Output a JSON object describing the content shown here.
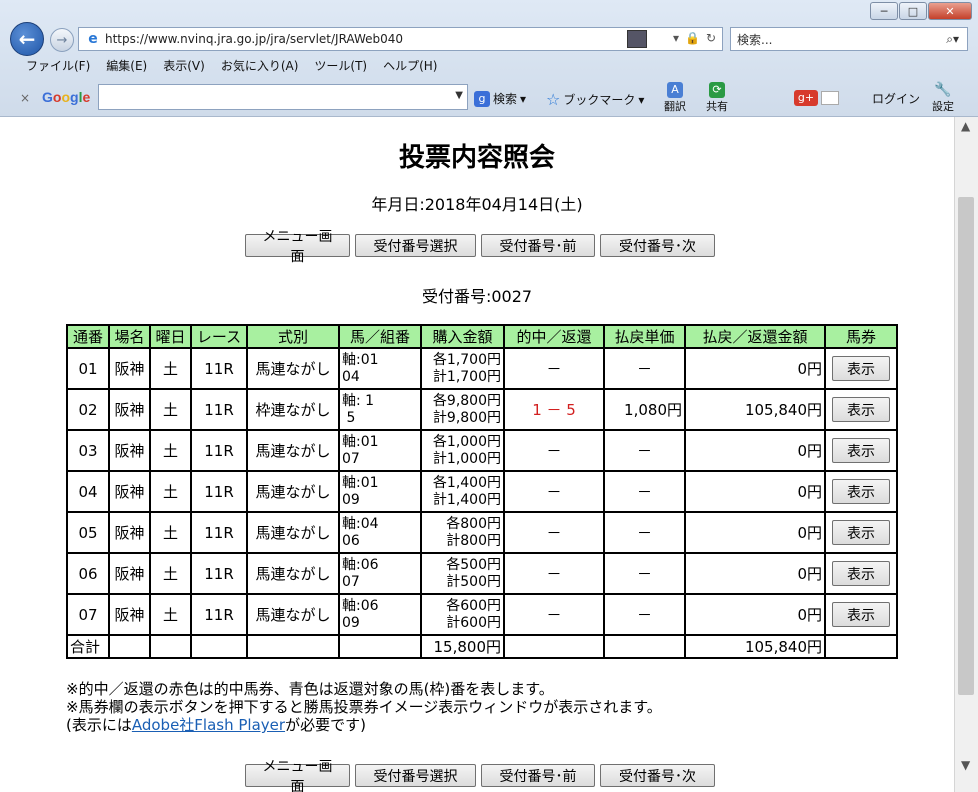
{
  "browser": {
    "url": "https://www.nvinq.jra.go.jp/jra/servlet/JRAWeb040",
    "search_placeholder": "検索...",
    "menu": [
      "ファイル(F)",
      "編集(E)",
      "表示(V)",
      "お気に入り(A)",
      "ツール(T)",
      "ヘルプ(H)"
    ],
    "toolbar": {
      "close": "×",
      "google": "Google",
      "search": "検索",
      "bookmark": "ブックマーク",
      "translate": "翻訳",
      "share": "共有",
      "login": "ログイン",
      "settings": "設定"
    }
  },
  "page": {
    "title": "投票内容照会",
    "date_line": "年月日:2018年04月14日(土)",
    "buttons": {
      "menu": "メニュー画面",
      "select": "受付番号選択",
      "prev": "受付番号･前",
      "next": "受付番号･次"
    },
    "receipt_line": "受付番号:0027",
    "table": {
      "headers": [
        "通番",
        "場名",
        "曜日",
        "レース",
        "式別",
        "馬／組番",
        "購入金額",
        "的中／返還",
        "払戻単価",
        "払戻／返還金額",
        "馬券"
      ],
      "rows": [
        {
          "no": "01",
          "venue": "阪神",
          "day": "土",
          "race": "11R",
          "type": "馬連ながし",
          "combo1": "軸:01",
          "combo2": "04",
          "amt1": "各1,700円",
          "amt2": "計1,700円",
          "hit": "－",
          "unit": "－",
          "payout": "0円",
          "btn": "表示"
        },
        {
          "no": "02",
          "venue": "阪神",
          "day": "土",
          "race": "11R",
          "type": "枠連ながし",
          "combo1": "軸: 1",
          "combo2": " 5",
          "amt1": "各9,800円",
          "amt2": "計9,800円",
          "hit": "1 － 5",
          "unit": "1,080円",
          "payout": "105,840円",
          "btn": "表示"
        },
        {
          "no": "03",
          "venue": "阪神",
          "day": "土",
          "race": "11R",
          "type": "馬連ながし",
          "combo1": "軸:01",
          "combo2": "07",
          "amt1": "各1,000円",
          "amt2": "計1,000円",
          "hit": "－",
          "unit": "－",
          "payout": "0円",
          "btn": "表示"
        },
        {
          "no": "04",
          "venue": "阪神",
          "day": "土",
          "race": "11R",
          "type": "馬連ながし",
          "combo1": "軸:01",
          "combo2": "09",
          "amt1": "各1,400円",
          "amt2": "計1,400円",
          "hit": "－",
          "unit": "－",
          "payout": "0円",
          "btn": "表示"
        },
        {
          "no": "05",
          "venue": "阪神",
          "day": "土",
          "race": "11R",
          "type": "馬連ながし",
          "combo1": "軸:04",
          "combo2": "06",
          "amt1": "各800円",
          "amt2": "計800円",
          "hit": "－",
          "unit": "－",
          "payout": "0円",
          "btn": "表示"
        },
        {
          "no": "06",
          "venue": "阪神",
          "day": "土",
          "race": "11R",
          "type": "馬連ながし",
          "combo1": "軸:06",
          "combo2": "07",
          "amt1": "各500円",
          "amt2": "計500円",
          "hit": "－",
          "unit": "－",
          "payout": "0円",
          "btn": "表示"
        },
        {
          "no": "07",
          "venue": "阪神",
          "day": "土",
          "race": "11R",
          "type": "馬連ながし",
          "combo1": "軸:06",
          "combo2": "09",
          "amt1": "各600円",
          "amt2": "計600円",
          "hit": "－",
          "unit": "－",
          "payout": "0円",
          "btn": "表示"
        }
      ],
      "total": {
        "label": "合計",
        "amount": "15,800円",
        "payout": "105,840円"
      }
    },
    "notes": {
      "line1": "※的中／返還の赤色は的中馬券、青色は返還対象の馬(枠)番を表します。",
      "line2": "※馬券欄の表示ボタンを押下すると勝馬投票券イメージ表示ウィンドウが表示されます。",
      "line3_prefix": "(表示には",
      "line3_link": "Adobe社Flash Player",
      "line3_suffix": "が必要です)"
    }
  }
}
